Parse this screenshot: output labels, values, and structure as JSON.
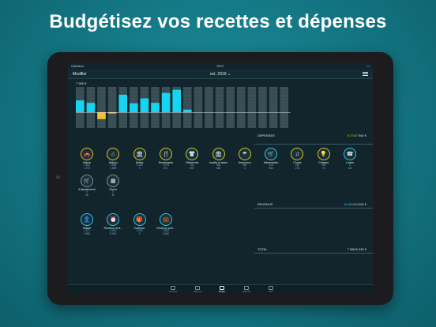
{
  "headline": "Budgétisez vos recettes et dépenses",
  "status": {
    "carrier": "Opérateur",
    "time": "09:07",
    "battery": ""
  },
  "navbar": {
    "edit_label": "Modifier",
    "month_label": "oct. 2019",
    "month_chevron": "⌄"
  },
  "chart_data": {
    "type": "bar",
    "top_label": "7 586 €",
    "values": [
      0.53,
      0.42,
      -0.3,
      -0.05,
      0.78,
      0.4,
      0.62,
      0.42,
      0.86,
      1.0,
      0.12,
      0.0,
      0.0,
      0.0,
      0.0,
      0.0,
      0.0,
      0.0,
      0.0,
      0.0
    ],
    "highlight": [
      false,
      false,
      true,
      true,
      false,
      false,
      false,
      false,
      false,
      false,
      false,
      false,
      false,
      false,
      false,
      false,
      false,
      false,
      false,
      false
    ],
    "colors": {
      "positive": "#17d4f0",
      "negative": "#f2c12e",
      "column": "#3b4f57",
      "line": "#d7dde0"
    }
  },
  "categories_row1": [
    {
      "name": "Voiture",
      "v1": "1 843",
      "v2": "1 972",
      "icon": "🚗",
      "ring": "yellow"
    },
    {
      "name": "Maison",
      "v1": "1 869",
      "v2": "1 859",
      "icon": "⌂",
      "ring": "yellow"
    },
    {
      "name": "Dettes",
      "v1": "1 406",
      "v2": "0",
      "icon": "🏛",
      "ring": "yellow"
    },
    {
      "name": "Restaurants",
      "v1": "1 079",
      "v2": "871",
      "icon": "🍴",
      "ring": "yellow"
    },
    {
      "name": "Vêtements",
      "v1": "761",
      "v2": "557",
      "icon": "👕",
      "ring": "yellow"
    },
    {
      "name": "Impôts et taxes",
      "v1": "466",
      "v2": "466",
      "icon": "🏛",
      "ring": "yellow"
    },
    {
      "name": "Assurance",
      "v1": "469",
      "v2": "0",
      "icon": "☂",
      "ring": "yellow"
    },
    {
      "name": "Alimentation",
      "v1": "224",
      "v2": "560",
      "icon": "🛒",
      "ring": "cyan"
    },
    {
      "name": "iTunes",
      "v1": "198",
      "v2": "278",
      "icon": "♫",
      "ring": "yellow"
    },
    {
      "name": "Charges",
      "v1": "190",
      "v2": "70",
      "icon": "💡",
      "ring": "yellow"
    },
    {
      "name": "Loisirs",
      "v1": "0",
      "v2": "120",
      "icon": "☎",
      "ring": "cyan"
    }
  ],
  "categories_row2": [
    {
      "name": "Entertainment",
      "v1": "0",
      "v2": "45",
      "icon": "🛒",
      "ring": "gray"
    },
    {
      "name": "Divers",
      "v1": "0",
      "v2": "30",
      "icon": "▦",
      "ring": "gray"
    }
  ],
  "income_row": [
    {
      "name": "Salaire",
      "v1": "1 377",
      "v2": "1 560",
      "icon": "👤",
      "ring": "cyan"
    },
    {
      "name": "Revenus de ll...",
      "v1": "8 540",
      "v2": "8 500",
      "icon": "⏰",
      "ring": "cyan"
    },
    {
      "name": "Cadeaux",
      "v1": "1 093",
      "v2": "0",
      "icon": "🎁",
      "ring": "cyan"
    },
    {
      "name": "Revenus prof...",
      "v1": "4 850",
      "v2": "1 560",
      "icon": "💼",
      "ring": "cyan"
    }
  ],
  "summary": {
    "depenses_label": "DÉPENSES",
    "depenses_actual": "8 274",
    "depenses_budget": "/7 564 €",
    "revenus_label": "REVENUS",
    "revenus_actual": "15 860",
    "revenus_budget": "/14 500 €",
    "total_label": "TOTAL",
    "total_actual": "7 586",
    "total_budget": "/6 936 €"
  },
  "tabs": [
    {
      "label": "Comptes",
      "active": false
    },
    {
      "label": "Rapports",
      "active": false
    },
    {
      "label": "Budget",
      "active": true
    },
    {
      "label": "Objectifs",
      "active": false
    },
    {
      "label": "Plus",
      "active": false
    }
  ]
}
